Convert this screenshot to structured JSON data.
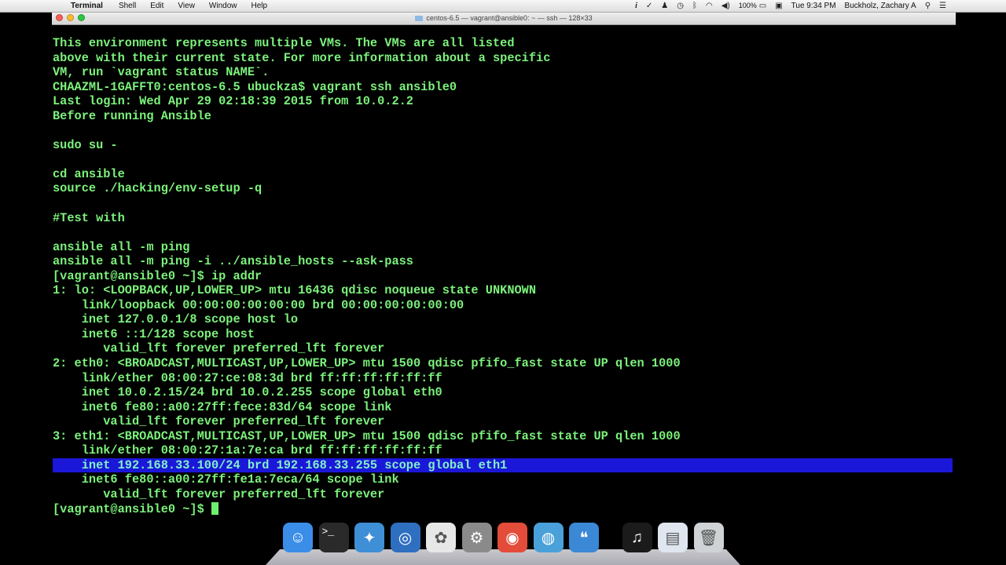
{
  "menubar": {
    "apple": "",
    "app_name": "Terminal",
    "menus": [
      "Shell",
      "Edit",
      "View",
      "Window",
      "Help"
    ],
    "battery": "100%",
    "clock": "Tue 9:34 PM",
    "user": "Buckholz, Zachary A"
  },
  "window": {
    "title": "centos-6.5 — vagrant@ansible0: ~ — ssh — 128×33"
  },
  "terminal": {
    "lines": [
      "This environment represents multiple VMs. The VMs are all listed",
      "above with their current state. For more information about a specific",
      "VM, run `vagrant status NAME`.",
      "CHAAZML-1GAFFT0:centos-6.5 ubuckza$ vagrant ssh ansible0",
      "Last login: Wed Apr 29 02:18:39 2015 from 10.0.2.2",
      "Before running Ansible",
      "",
      "sudo su -",
      "",
      "cd ansible",
      "source ./hacking/env-setup -q",
      "",
      "#Test with",
      "",
      "ansible all -m ping",
      "ansible all -m ping -i ../ansible_hosts --ask-pass",
      "[vagrant@ansible0 ~]$ ip addr",
      "1: lo: <LOOPBACK,UP,LOWER_UP> mtu 16436 qdisc noqueue state UNKNOWN",
      "    link/loopback 00:00:00:00:00:00 brd 00:00:00:00:00:00",
      "    inet 127.0.0.1/8 scope host lo",
      "    inet6 ::1/128 scope host",
      "       valid_lft forever preferred_lft forever",
      "2: eth0: <BROADCAST,MULTICAST,UP,LOWER_UP> mtu 1500 qdisc pfifo_fast state UP qlen 1000",
      "    link/ether 08:00:27:ce:08:3d brd ff:ff:ff:ff:ff:ff",
      "    inet 10.0.2.15/24 brd 10.0.2.255 scope global eth0",
      "    inet6 fe80::a00:27ff:fece:83d/64 scope link",
      "       valid_lft forever preferred_lft forever",
      "3: eth1: <BROADCAST,MULTICAST,UP,LOWER_UP> mtu 1500 qdisc pfifo_fast state UP qlen 1000",
      "    link/ether 08:00:27:1a:7e:ca brd ff:ff:ff:ff:ff:ff",
      "    inet 192.168.33.100/24 brd 192.168.33.255 scope global eth1",
      "    inet6 fe80::a00:27ff:fe1a:7eca/64 scope link",
      "       valid_lft forever preferred_lft forever",
      "[vagrant@ansible0 ~]$ "
    ],
    "highlighted_line": 29,
    "text_color": "#7cf27c",
    "highlight_color": "#1b17d8"
  },
  "dock": {
    "icons": [
      {
        "name": "finder-icon",
        "color": "#3b8ee8"
      },
      {
        "name": "terminal-icon",
        "color": "#2a2a2a"
      },
      {
        "name": "safari-icon",
        "color": "#3f8fd6"
      },
      {
        "name": "quicktime-icon",
        "color": "#2f6fbf"
      },
      {
        "name": "photos-icon",
        "color": "#e7e7e7"
      },
      {
        "name": "system-preferences-icon",
        "color": "#8a8a8a"
      },
      {
        "name": "chrome-icon",
        "color": "#e44c3a"
      },
      {
        "name": "network-globe-icon",
        "color": "#4aa0d8"
      },
      {
        "name": "chat-bubble-icon",
        "color": "#3a88d6"
      },
      {
        "name": "itunes-icon",
        "color": "#1b1b1b"
      },
      {
        "name": "documents-stack-icon",
        "color": "#dfe6ef"
      },
      {
        "name": "trash-icon",
        "color": "#cfd3d6"
      }
    ]
  }
}
